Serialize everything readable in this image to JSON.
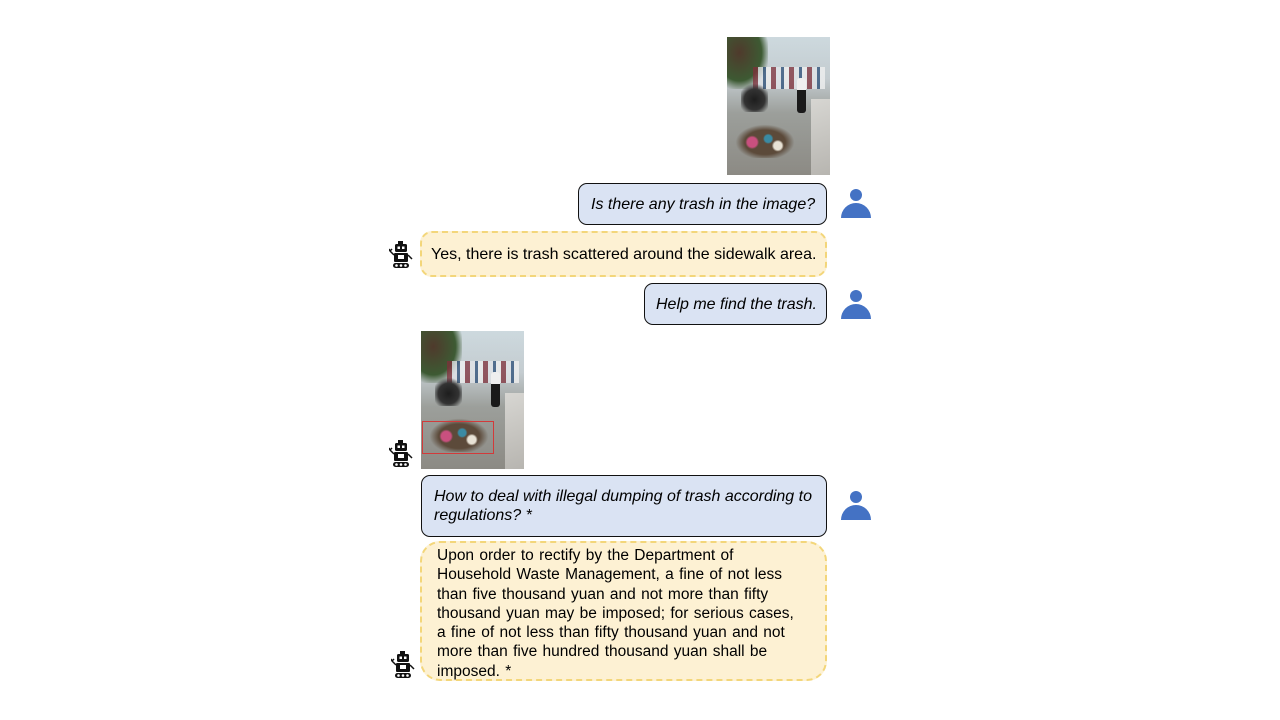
{
  "conversation": {
    "msg1_user": "Is there any trash in the image?",
    "msg2_bot": "Yes, there is trash scattered around the sidewalk area.",
    "msg3_user": "Help me find the trash.",
    "msg5_user": "How to deal with illegal dumping of trash according to regulations? *",
    "msg6_bot": "Upon order to rectify by the Department of Household Waste Management, a fine of not less than five thousand yuan and not more than fifty thousand yuan may be imposed; for serious cases, a fine of not less than fifty thousand yuan and not more than five hundred thousand yuan shall be imposed. *"
  },
  "icons": {
    "user": "person-icon",
    "bot": "robot-icon"
  },
  "colors": {
    "user_bubble": "#dae3f3",
    "bot_bubble": "#fdf1d3",
    "bot_border": "#f3d67a",
    "avatar": "#4472c4",
    "bbox": "#d23a3a"
  }
}
